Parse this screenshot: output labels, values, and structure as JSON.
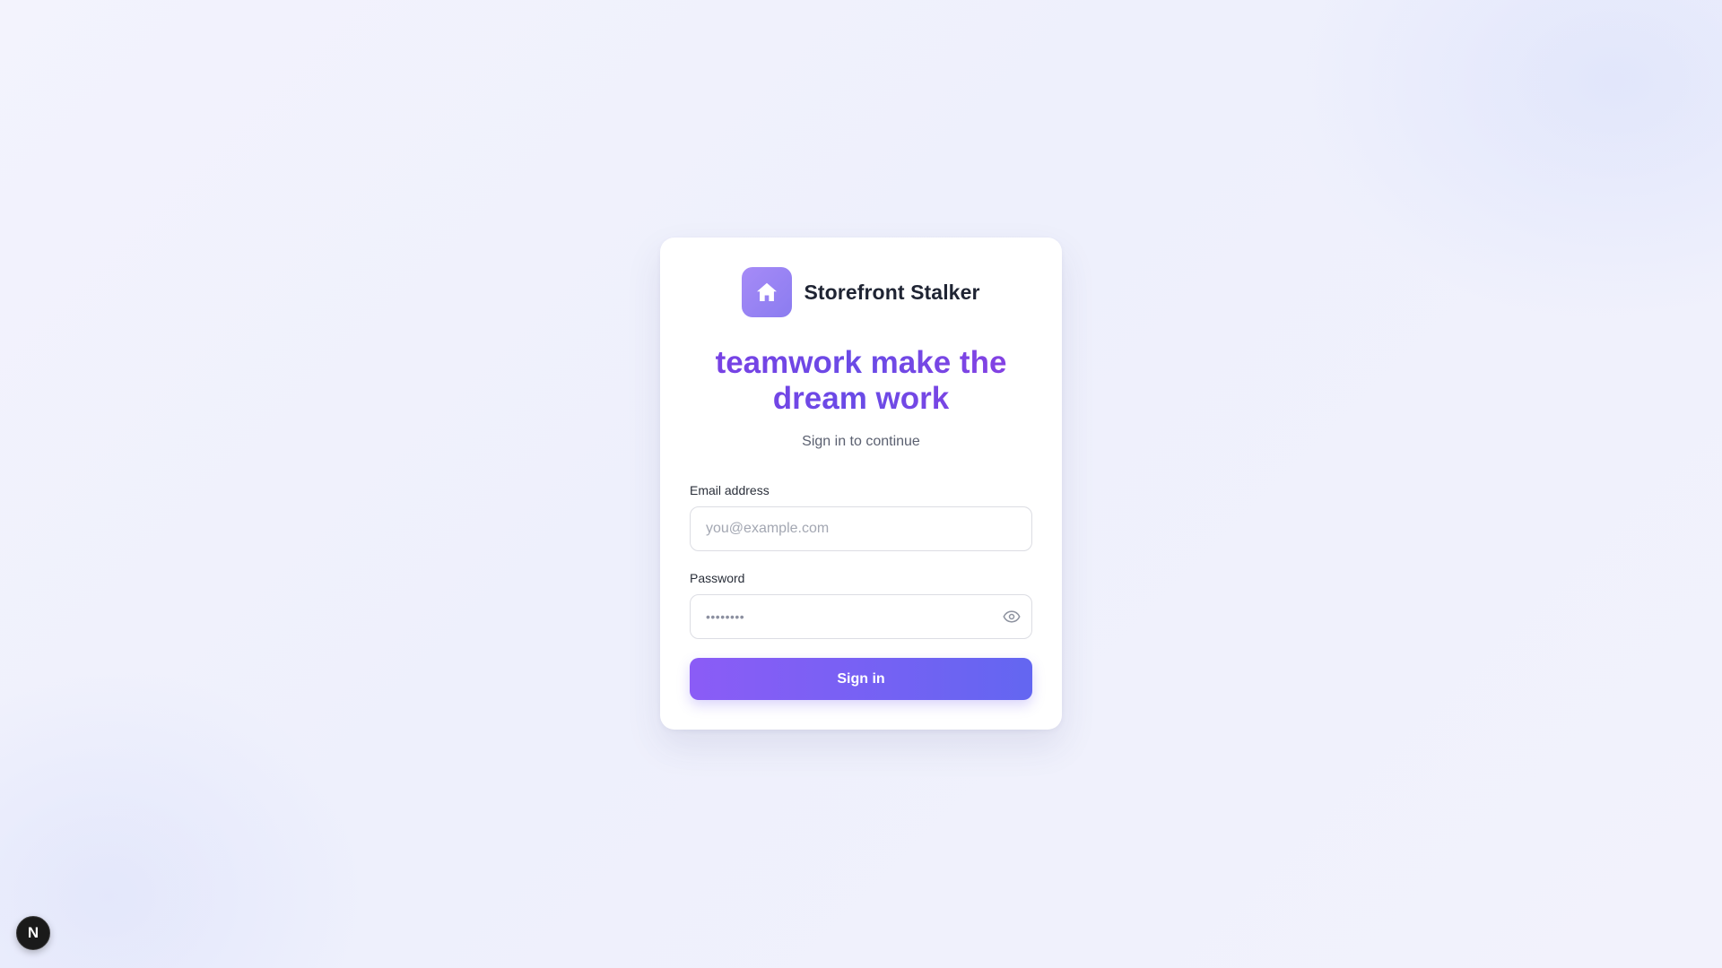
{
  "app": {
    "name": "Storefront Stalker",
    "logo_icon": "home-icon",
    "logo_color": "#9b85f5"
  },
  "login": {
    "headline": "teamwork make the dream work",
    "subtitle": "Sign in to continue",
    "email_label": "Email address",
    "email_placeholder": "you@example.com",
    "email_value": "",
    "password_label": "Password",
    "password_mask": "••••••••",
    "password_toggle_icon": "eye-icon",
    "submit_label": "Sign in"
  },
  "colors": {
    "accent_start": "#8b5cf6",
    "accent_end": "#6366f1",
    "headline": "#6d44e3"
  },
  "dev_badge": {
    "label": "N",
    "icon": "nextjs-icon"
  }
}
